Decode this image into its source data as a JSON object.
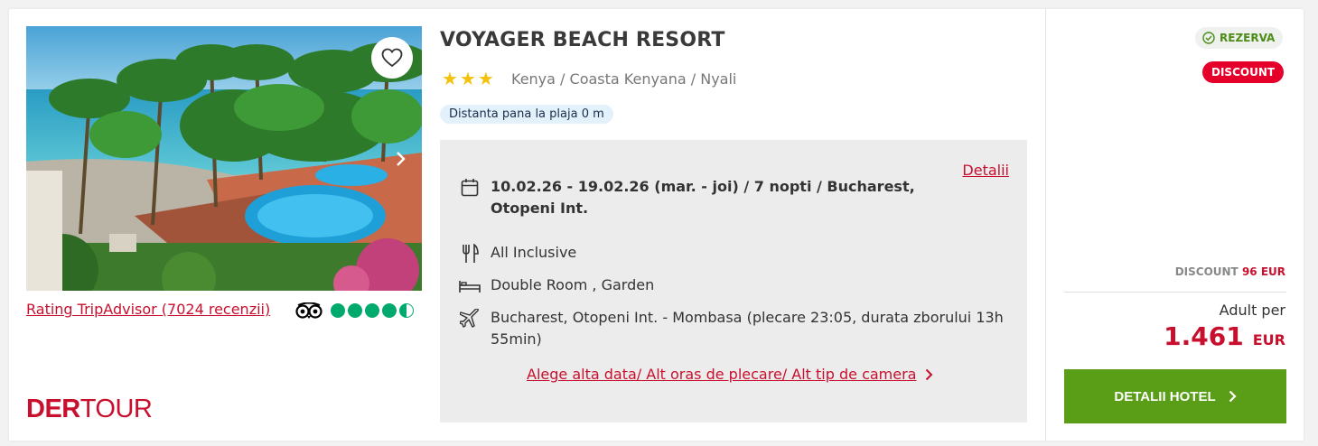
{
  "hotel": {
    "name": "VOYAGER BEACH RESORT",
    "stars": 3,
    "location": "Kenya / Coasta Kenyana / Nyali",
    "beach_distance": "Distanta pana la plaja 0 m"
  },
  "rating": {
    "link_text": "Rating TripAdvisor (7024 recenzii)",
    "score": 4.5,
    "max": 5
  },
  "brand": {
    "logo_part1": "DER",
    "logo_part2": "TOUR"
  },
  "offer": {
    "details_link": "Detalii",
    "dates": "10.02.26 - 19.02.26 (mar. - joi) / 7 nopti / Bucharest, Otopeni Int.",
    "board": "All Inclusive",
    "room": "Double Room , Garden",
    "flight": "Bucharest, Otopeni Int. - Mombasa (plecare 23:05, durata zborului 13h 55min)",
    "alt_link": "Alege alta data/ Alt oras de plecare/ Alt tip de camera"
  },
  "pricing": {
    "badge_reserve": "REZERVA",
    "badge_discount": "DISCOUNT",
    "discount_label": "DISCOUNT",
    "discount_amount": "96 EUR",
    "per_label": "Adult per",
    "price": "1.461",
    "currency": "EUR",
    "cta": "DETALII HOTEL"
  },
  "colors": {
    "brand_red": "#c8102e",
    "discount_red": "#e4002b",
    "cta_green": "#5a9e18",
    "star_yellow": "#f4c20d",
    "tripadvisor_green": "#00aa6c"
  },
  "icons": {
    "favorite": "heart-icon",
    "next": "chevron-right-icon",
    "calendar": "calendar-icon",
    "meal": "cutlery-icon",
    "room": "bed-icon",
    "flight": "airplane-icon",
    "reserve": "check-circle-icon",
    "tripadvisor": "owl-icon"
  }
}
